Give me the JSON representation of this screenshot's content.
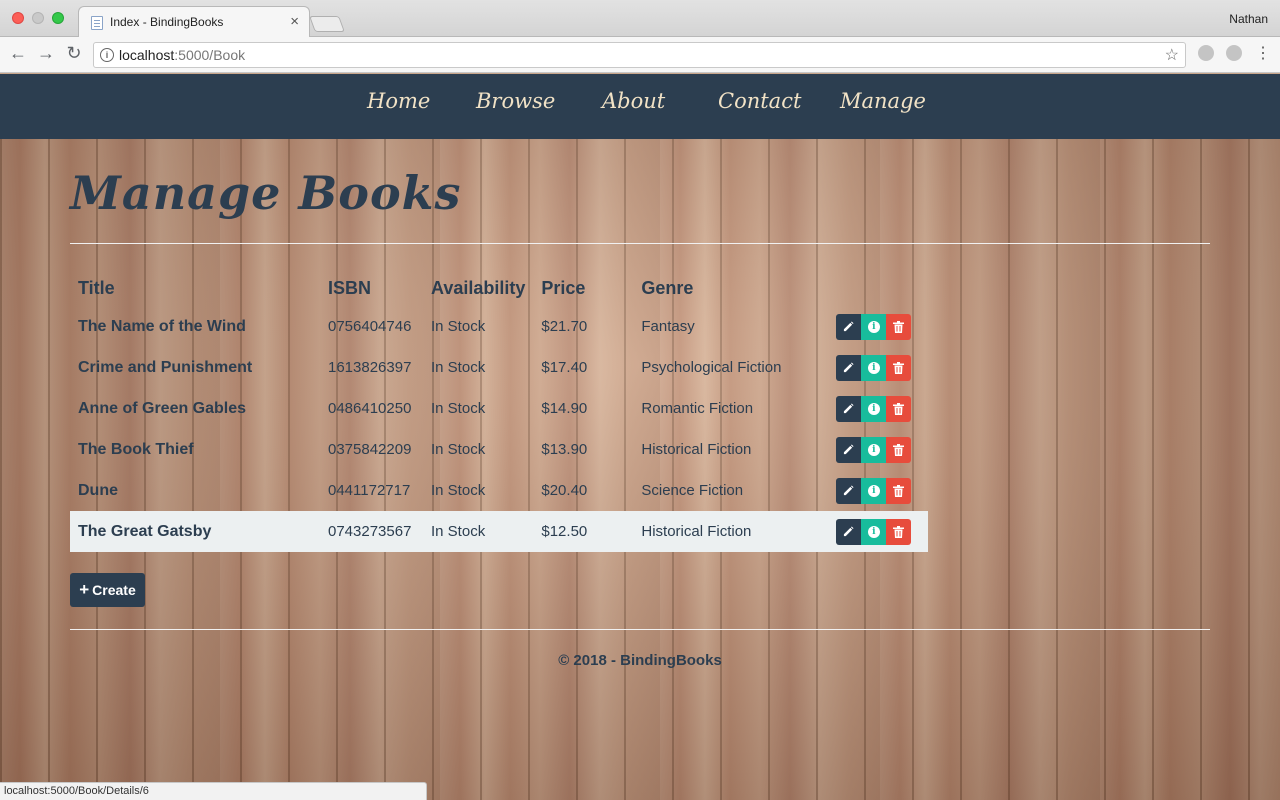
{
  "browser": {
    "tab_title": "Index - BindingBooks",
    "tab_close": "×",
    "user": "Nathan",
    "url_host": "localhost",
    "url_rest": ":5000/Book",
    "status_url": "localhost:5000/Book/Details/6"
  },
  "nav": {
    "items": [
      {
        "label": "Home"
      },
      {
        "label": "Browse"
      },
      {
        "label": "About"
      },
      {
        "label": "Contact"
      },
      {
        "label": "Manage"
      }
    ]
  },
  "page": {
    "title": "Manage Books",
    "create_label": "Create",
    "footer": "© 2018 - BindingBooks"
  },
  "table": {
    "headers": [
      "Title",
      "ISBN",
      "Availability",
      "Price",
      "Genre"
    ],
    "rows": [
      {
        "title": "The Name of the Wind",
        "isbn": "0756404746",
        "availability": "In Stock",
        "price": "$21.70",
        "genre": "Fantasy"
      },
      {
        "title": "Crime and Punishment",
        "isbn": "1613826397",
        "availability": "In Stock",
        "price": "$17.40",
        "genre": "Psychological Fiction"
      },
      {
        "title": "Anne of Green Gables",
        "isbn": "0486410250",
        "availability": "In Stock",
        "price": "$14.90",
        "genre": "Romantic Fiction"
      },
      {
        "title": "The Book Thief",
        "isbn": "0375842209",
        "availability": "In Stock",
        "price": "$13.90",
        "genre": "Historical Fiction"
      },
      {
        "title": "Dune",
        "isbn": "0441172717",
        "availability": "In Stock",
        "price": "$20.40",
        "genre": "Science Fiction"
      },
      {
        "title": "The Great Gatsby",
        "isbn": "0743273567",
        "availability": "In Stock",
        "price": "$12.50",
        "genre": "Historical Fiction"
      }
    ],
    "hovered_row": 5
  },
  "colors": {
    "navbar": "#2c3e50",
    "edit": "#2c3e50",
    "info": "#18bc9c",
    "delete": "#e74c3c"
  }
}
